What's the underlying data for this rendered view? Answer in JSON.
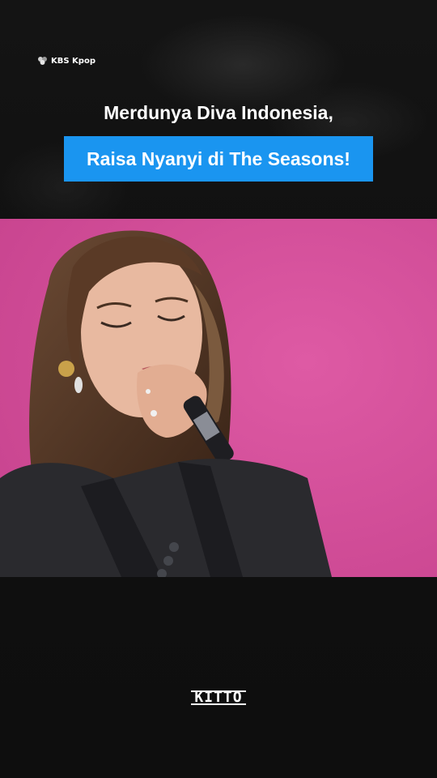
{
  "channel": {
    "name": "KBS Kpop",
    "icon": "kbs-logo-icon"
  },
  "headline": {
    "line1": "Merdunya Diva Indonesia,",
    "line2": "Raisa Nyanyi di The Seasons!",
    "highlight_color": "#1a95f0"
  },
  "video": {
    "background_color": "#d6509a"
  },
  "brand": {
    "logo": "KITTO"
  }
}
